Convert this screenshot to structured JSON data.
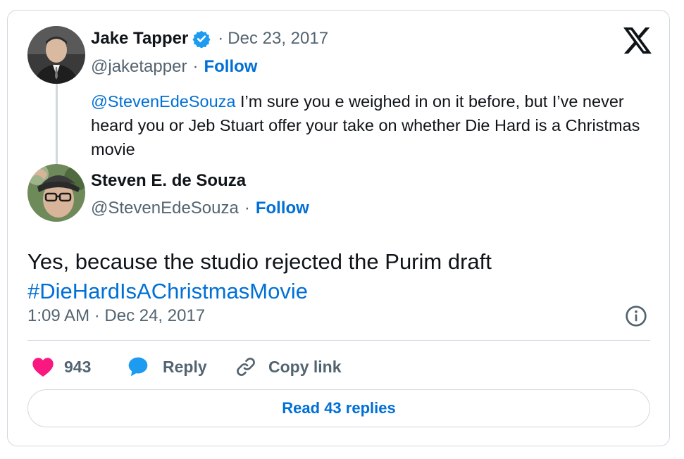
{
  "quoted_tweet": {
    "author_name": "Jake Tapper",
    "handle": "@jaketapper",
    "separator": "·",
    "date": "Dec 23, 2017",
    "follow_label": "Follow",
    "mention": "@StevenEdeSouza",
    "text": " I’m sure you e weighed in on it before, but I’ve never heard you or Jeb Stuart offer your take on whether Die Hard is a Christmas movie",
    "verified_icon": "verified-badge-icon",
    "verified_color": "#1d9bf0"
  },
  "tweet": {
    "author_name": "Steven E. de Souza",
    "handle": "@StevenEdeSouza",
    "separator": "·",
    "follow_label": "Follow",
    "text": "Yes, because the studio rejected the Purim draft",
    "hashtag": "#DieHardIsAChristmasMovie",
    "timestamp": "1:09 AM · Dec 24, 2017"
  },
  "actions": {
    "like_count": "943",
    "reply_label": "Reply",
    "copy_link_label": "Copy link"
  },
  "footer": {
    "read_replies_label": "Read 43 replies"
  },
  "colors": {
    "link": "#006fd6",
    "like": "#f91880",
    "reply_icon": "#1d9bf0",
    "muted": "#536471",
    "border": "#cfd9de"
  }
}
